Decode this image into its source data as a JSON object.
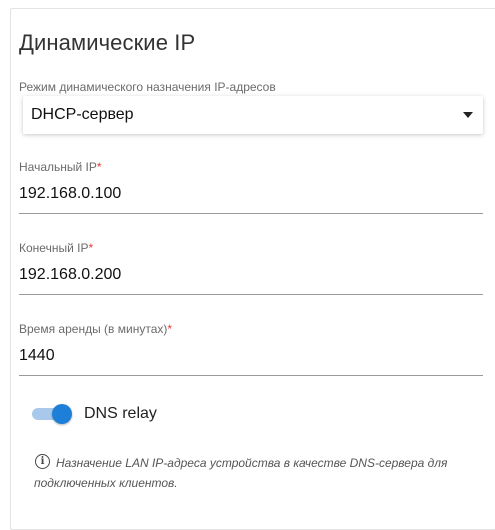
{
  "section": {
    "title": "Динамические IP"
  },
  "mode": {
    "label": "Режим динамического назначения IP-адресов",
    "value": "DHCP-сервер"
  },
  "start_ip": {
    "label": "Начальный IP",
    "required_mark": "*",
    "value": "192.168.0.100"
  },
  "end_ip": {
    "label": "Конечный IP",
    "required_mark": "*",
    "value": "192.168.0.200"
  },
  "lease": {
    "label": "Время аренды (в минутах)",
    "required_mark": "*",
    "value": "1440"
  },
  "dns_relay": {
    "label": "DNS relay",
    "enabled": true
  },
  "info": {
    "icon": "info-icon",
    "text": "Назначение LAN IP-адреса устройства в качестве DNS-сервера для подключенных клиентов."
  },
  "colors": {
    "accent": "#1e7fd8",
    "required": "#e53935"
  }
}
